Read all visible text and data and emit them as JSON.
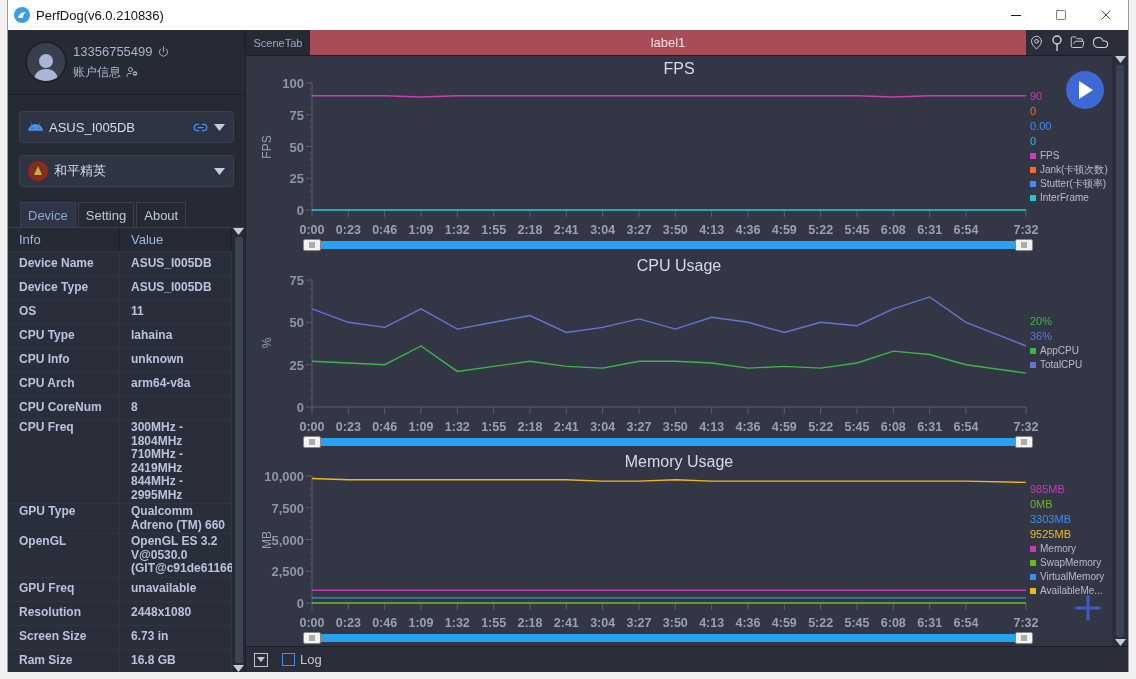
{
  "window": {
    "title": "PerfDog(v6.0.210836)"
  },
  "account": {
    "phone": "13356755499",
    "info_label": "账户信息"
  },
  "device_select": {
    "value": "ASUS_I005DB"
  },
  "app_select": {
    "value": "和平精英"
  },
  "tabs": [
    {
      "label": "Device",
      "selected": true
    },
    {
      "label": "Setting",
      "selected": false
    },
    {
      "label": "About",
      "selected": false
    }
  ],
  "table": {
    "columns": [
      "Info",
      "Value"
    ],
    "rows": [
      [
        "Device Name",
        "ASUS_I005DB"
      ],
      [
        "Device Type",
        "ASUS_I005DB"
      ],
      [
        "OS",
        "11"
      ],
      [
        "CPU Type",
        "lahaina"
      ],
      [
        "CPU Info",
        "unknown"
      ],
      [
        "CPU Arch",
        "arm64-v8a"
      ],
      [
        "CPU CoreNum",
        "8"
      ],
      [
        "CPU Freq",
        "300MHz -\n1804MHz\n710MHz -\n2419MHz\n844MHz -\n2995MHz"
      ],
      [
        "GPU Type",
        "Qualcomm\nAdreno (TM) 660"
      ],
      [
        "OpenGL",
        "OpenGL ES 3.2\nV@0530.0\n(GIT@c91de61166"
      ],
      [
        "GPU Freq",
        "unavailable"
      ],
      [
        "Resolution",
        "2448x1080"
      ],
      [
        "Screen Size",
        "6.73 in"
      ],
      [
        "Ram Size",
        "16.8 GB"
      ]
    ]
  },
  "scene_bar": {
    "tab": "SceneTab",
    "label": "label1"
  },
  "charts": [
    {
      "readings": [
        "90",
        "0",
        "0.00",
        "0"
      ],
      "chart_data": {
        "type": "line",
        "title": "FPS",
        "ylabel": "FPS",
        "x": [
          0,
          23,
          46,
          69,
          92,
          115,
          138,
          161,
          184,
          207,
          230,
          253,
          276,
          299,
          322,
          345,
          368,
          391,
          414,
          452
        ],
        "xlim": [
          0,
          452
        ],
        "ylim": [
          0,
          100
        ],
        "yticks": [
          0,
          25,
          50,
          75,
          100
        ],
        "xticks": [
          {
            "value": 0,
            "label": "0:00"
          },
          {
            "value": 23,
            "label": "0:23"
          },
          {
            "value": 46,
            "label": "0:46"
          },
          {
            "value": 69,
            "label": "1:09"
          },
          {
            "value": 92,
            "label": "1:32"
          },
          {
            "value": 115,
            "label": "1:55"
          },
          {
            "value": 138,
            "label": "2:18"
          },
          {
            "value": 161,
            "label": "2:41"
          },
          {
            "value": 184,
            "label": "3:04"
          },
          {
            "value": 207,
            "label": "3:27"
          },
          {
            "value": 230,
            "label": "3:50"
          },
          {
            "value": 253,
            "label": "4:13"
          },
          {
            "value": 276,
            "label": "4:36"
          },
          {
            "value": 299,
            "label": "4:59"
          },
          {
            "value": 322,
            "label": "5:22"
          },
          {
            "value": 345,
            "label": "5:45"
          },
          {
            "value": 368,
            "label": "6:08"
          },
          {
            "value": 391,
            "label": "6:31"
          },
          {
            "value": 414,
            "label": "6:54"
          },
          {
            "value": 452,
            "label": "7:32"
          }
        ],
        "series": [
          {
            "name": "FPS",
            "color": "#c83fb6",
            "values": [
              90,
              90,
              90,
              89,
              90,
              90,
              90,
              90,
              90,
              90,
              90,
              90,
              90,
              90,
              90,
              90,
              89,
              90,
              90,
              90
            ]
          },
          {
            "name": "Jank(卡顿次数)",
            "color": "#ff6a21",
            "values": [
              null,
              null,
              null,
              null,
              null,
              null,
              null,
              null,
              null,
              null,
              null,
              null,
              null,
              null,
              null,
              null,
              null,
              null,
              null,
              null
            ]
          },
          {
            "name": "Stutter(卡顿率)",
            "color": "#3f8ef0",
            "values": [
              null,
              null,
              null,
              null,
              null,
              null,
              null,
              null,
              null,
              null,
              null,
              null,
              null,
              null,
              null,
              null,
              null,
              null,
              null,
              null
            ]
          },
          {
            "name": "InterFrame",
            "color": "#1ec8d8",
            "values": [
              0,
              0,
              0,
              0,
              0,
              0,
              0,
              0,
              0,
              0,
              0,
              0,
              0,
              0,
              0,
              0,
              0,
              0,
              0,
              0
            ]
          }
        ]
      }
    },
    {
      "readings": [
        "20%",
        "36%"
      ],
      "chart_data": {
        "type": "line",
        "title": "CPU Usage",
        "ylabel": "%",
        "x": [
          0,
          23,
          46,
          69,
          92,
          115,
          138,
          161,
          184,
          207,
          230,
          253,
          276,
          299,
          322,
          345,
          368,
          391,
          414,
          452
        ],
        "xlim": [
          0,
          452
        ],
        "ylim": [
          0,
          75
        ],
        "yticks": [
          0,
          25,
          50,
          75
        ],
        "xticks": [
          {
            "value": 0,
            "label": "0:00"
          },
          {
            "value": 23,
            "label": "0:23"
          },
          {
            "value": 46,
            "label": "0:46"
          },
          {
            "value": 69,
            "label": "1:09"
          },
          {
            "value": 92,
            "label": "1:32"
          },
          {
            "value": 115,
            "label": "1:55"
          },
          {
            "value": 138,
            "label": "2:18"
          },
          {
            "value": 161,
            "label": "2:41"
          },
          {
            "value": 184,
            "label": "3:04"
          },
          {
            "value": 207,
            "label": "3:27"
          },
          {
            "value": 230,
            "label": "3:50"
          },
          {
            "value": 253,
            "label": "4:13"
          },
          {
            "value": 276,
            "label": "4:36"
          },
          {
            "value": 299,
            "label": "4:59"
          },
          {
            "value": 322,
            "label": "5:22"
          },
          {
            "value": 345,
            "label": "5:45"
          },
          {
            "value": 368,
            "label": "6:08"
          },
          {
            "value": 391,
            "label": "6:31"
          },
          {
            "value": 414,
            "label": "6:54"
          },
          {
            "value": 452,
            "label": "7:32"
          }
        ],
        "series": [
          {
            "name": "AppCPU",
            "color": "#3bb54a",
            "values": [
              27,
              26,
              25,
              36,
              21,
              24,
              27,
              24,
              23,
              27,
              27,
              26,
              23,
              24,
              23,
              26,
              33,
              31,
              25,
              20
            ]
          },
          {
            "name": "TotalCPU",
            "color": "#6674d6",
            "values": [
              58,
              50,
              47,
              58,
              46,
              50,
              54,
              44,
              47,
              52,
              46,
              53,
              50,
              44,
              50,
              48,
              58,
              65,
              50,
              36
            ]
          }
        ]
      }
    },
    {
      "readings": [
        "985MB",
        "0MB",
        "3303MB",
        "9525MB"
      ],
      "chart_data": {
        "type": "line",
        "title": "Memory Usage",
        "ylabel": "MB",
        "x": [
          0,
          23,
          46,
          69,
          92,
          115,
          138,
          161,
          184,
          207,
          230,
          253,
          276,
          299,
          322,
          345,
          368,
          391,
          414,
          452
        ],
        "xlim": [
          0,
          452
        ],
        "ylim": [
          0,
          10000
        ],
        "yticks": [
          0,
          {
            "value": 2500,
            "label": "2,500"
          },
          {
            "value": 5000,
            "label": "5,000"
          },
          {
            "value": 7500,
            "label": "7,500"
          },
          {
            "value": 10000,
            "label": "10,000"
          }
        ],
        "xticks": [
          {
            "value": 0,
            "label": "0:00"
          },
          {
            "value": 23,
            "label": "0:23"
          },
          {
            "value": 46,
            "label": "0:46"
          },
          {
            "value": 69,
            "label": "1:09"
          },
          {
            "value": 92,
            "label": "1:32"
          },
          {
            "value": 115,
            "label": "1:55"
          },
          {
            "value": 138,
            "label": "2:18"
          },
          {
            "value": 161,
            "label": "2:41"
          },
          {
            "value": 184,
            "label": "3:04"
          },
          {
            "value": 207,
            "label": "3:27"
          },
          {
            "value": 230,
            "label": "3:50"
          },
          {
            "value": 253,
            "label": "4:13"
          },
          {
            "value": 276,
            "label": "4:36"
          },
          {
            "value": 299,
            "label": "4:59"
          },
          {
            "value": 322,
            "label": "5:22"
          },
          {
            "value": 345,
            "label": "5:45"
          },
          {
            "value": 368,
            "label": "6:08"
          },
          {
            "value": 391,
            "label": "6:31"
          },
          {
            "value": 414,
            "label": "6:54"
          },
          {
            "value": 452,
            "label": "7:32"
          }
        ],
        "series": [
          {
            "name": "Memory",
            "color": "#c43cb4",
            "values": [
              1000,
              1000,
              1000,
              1000,
              1000,
              1000,
              1000,
              1000,
              1000,
              1000,
              1000,
              1000,
              1000,
              1000,
              1000,
              1000,
              1000,
              1000,
              1000,
              1000
            ]
          },
          {
            "name": "SwapMemory",
            "color": "#6ab81e",
            "values": [
              0,
              0,
              0,
              0,
              0,
              0,
              0,
              0,
              0,
              0,
              0,
              0,
              0,
              0,
              0,
              0,
              0,
              0,
              0,
              0
            ]
          },
          {
            "name": "VirtualMemory",
            "color": "#3f8ef0",
            "values": [
              400,
              400,
              400,
              400,
              400,
              400,
              400,
              400,
              400,
              400,
              400,
              400,
              400,
              400,
              400,
              400,
              400,
              400,
              400,
              400
            ]
          },
          {
            "name": "AvailableMe...",
            "color": "#f0b81e",
            "values": [
              9800,
              9700,
              9700,
              9700,
              9700,
              9700,
              9700,
              9700,
              9600,
              9600,
              9700,
              9600,
              9600,
              9600,
              9600,
              9600,
              9600,
              9600,
              9600,
              9500
            ]
          }
        ]
      }
    }
  ],
  "sliders": [
    {
      "level": 1
    },
    {
      "level": 1
    },
    {
      "level": 1
    }
  ],
  "bottom_bar": {
    "log": {
      "label": "Log",
      "checked": false
    }
  }
}
